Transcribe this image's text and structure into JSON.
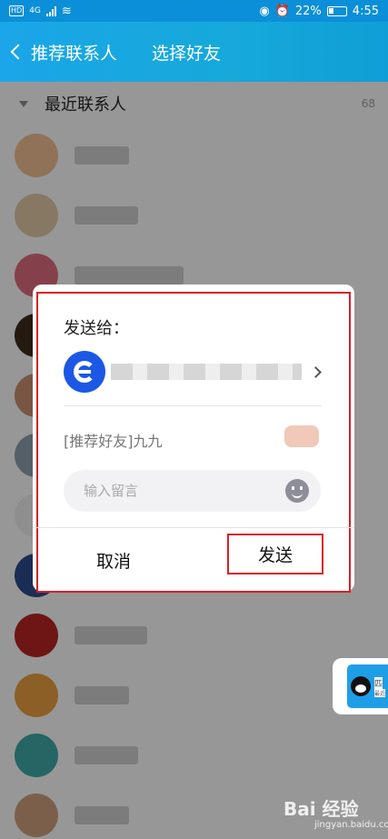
{
  "status_bar": {
    "hd": "HD",
    "network": "4G",
    "battery_percent": "22%",
    "time": "4:55"
  },
  "header": {
    "back_label": "推荐联系人",
    "title": "选择好友"
  },
  "section": {
    "title": "最近联系人",
    "count": "68"
  },
  "contacts": [
    {
      "avatar_color": "#e7b98d"
    },
    {
      "avatar_color": "#d9c2a0"
    },
    {
      "avatar_color": "#d76a7a"
    },
    {
      "avatar_color": "#3a2b1a"
    },
    {
      "avatar_color": "#c28c6c"
    },
    {
      "avatar_color": "#8a9aa8"
    },
    {
      "avatar_color": "#e6e6e6"
    },
    {
      "avatar_color": "#2a4a8a"
    },
    {
      "avatar_color": "#b22222"
    },
    {
      "avatar_color": "#e19a3c"
    },
    {
      "avatar_color": "#3ca3a0"
    },
    {
      "avatar_color": "#c89a7a"
    }
  ],
  "dialog": {
    "send_to_label": "发送给：",
    "card_text": "[推荐好友]九九",
    "message_placeholder": "输入留言",
    "cancel_label": "取消",
    "send_label": "发送"
  },
  "float_badge": {
    "line1": "匹",
    "line2": "最近"
  },
  "watermark": {
    "brand": "Bai 经验",
    "url": "jingyan.baidu.com"
  },
  "colors": {
    "header_blue": "#16a9da",
    "highlight_red": "#d92026",
    "recipient_blue": "#1c58e6"
  }
}
